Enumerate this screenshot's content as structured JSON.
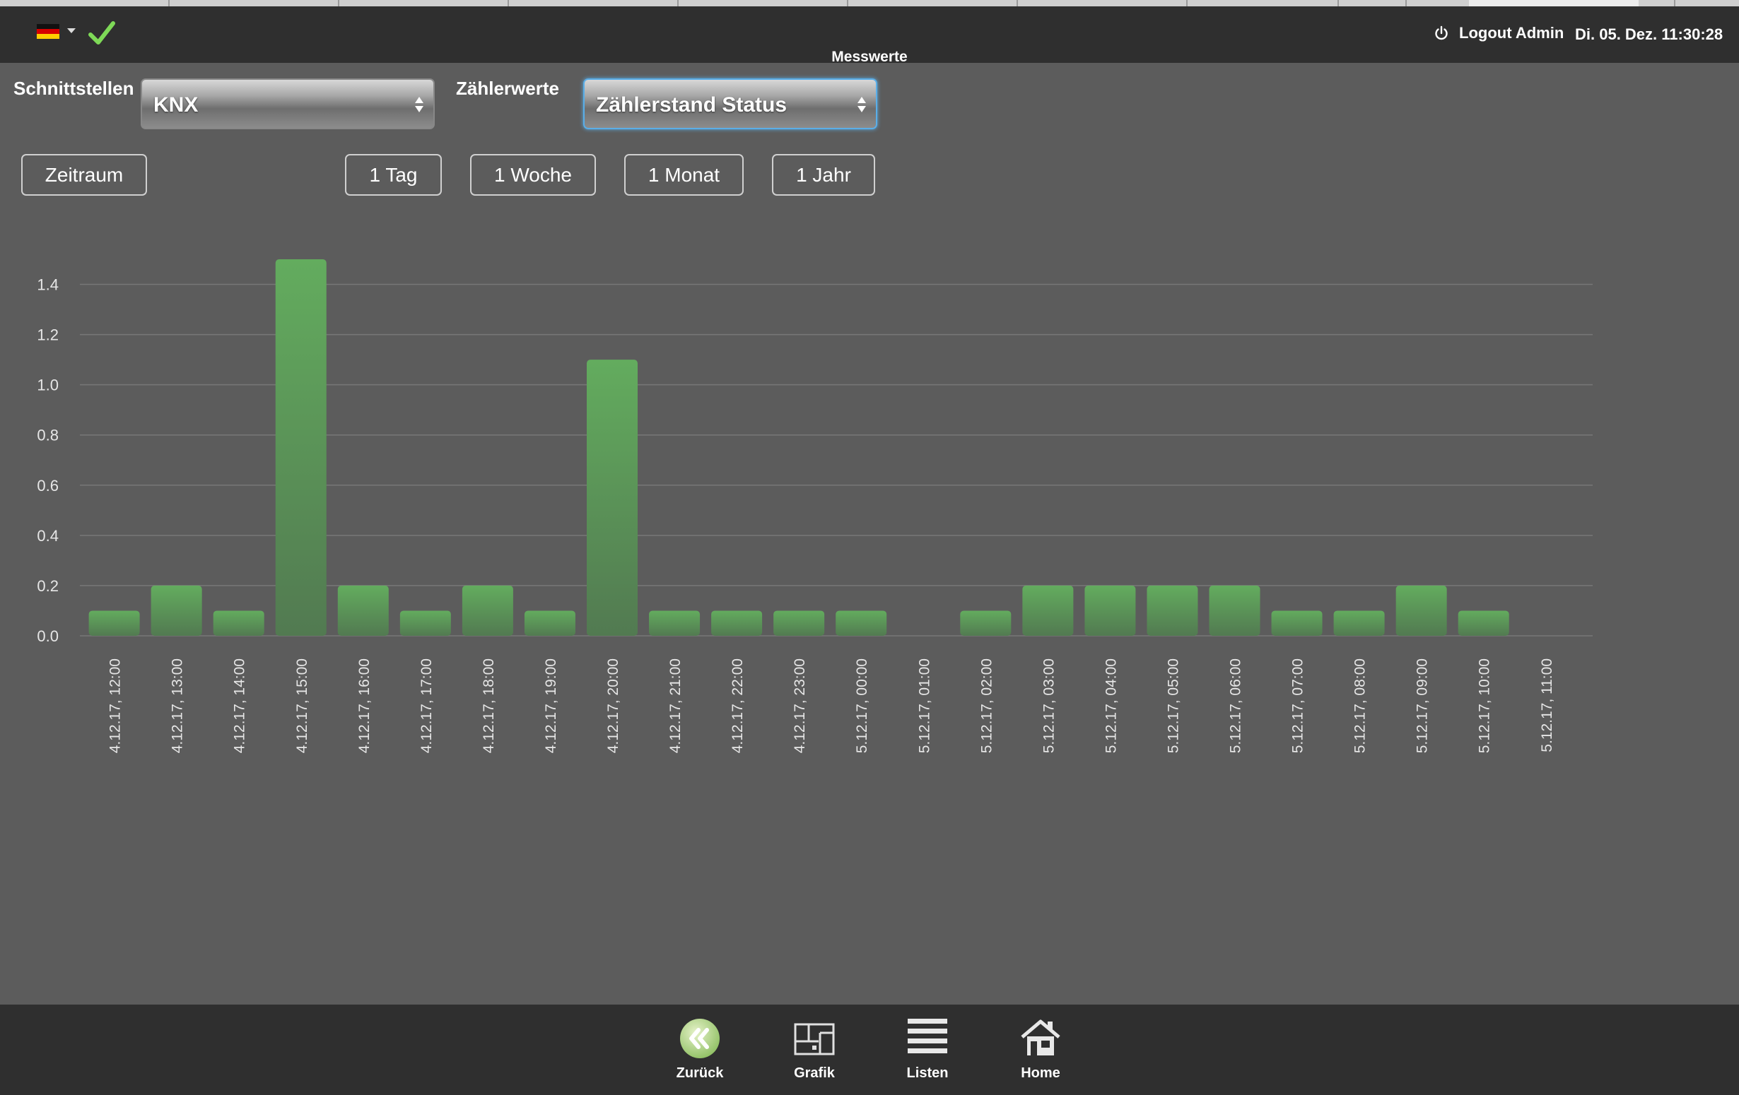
{
  "header": {
    "title": "Messwerte",
    "logout_label": "Logout Admin",
    "datetime": "Di. 05. Dez. 11:30:28",
    "language": "de"
  },
  "filters": {
    "interfaces_label": "Schnittstellen",
    "interfaces_value": "KNX",
    "meter_label": "Zählerwerte",
    "meter_value": "Zählerstand Status"
  },
  "timerange": {
    "custom_label": "Zeitraum",
    "day_label": "1 Tag",
    "week_label": "1 Woche",
    "month_label": "1 Monat",
    "year_label": "1 Jahr"
  },
  "chart_data": {
    "type": "bar",
    "categories": [
      "4.12.17, 12:00",
      "4.12.17, 13:00",
      "4.12.17, 14:00",
      "4.12.17, 15:00",
      "4.12.17, 16:00",
      "4.12.17, 17:00",
      "4.12.17, 18:00",
      "4.12.17, 19:00",
      "4.12.17, 20:00",
      "4.12.17, 21:00",
      "4.12.17, 22:00",
      "4.12.17, 23:00",
      "5.12.17, 00:00",
      "5.12.17, 01:00",
      "5.12.17, 02:00",
      "5.12.17, 03:00",
      "5.12.17, 04:00",
      "5.12.17, 05:00",
      "5.12.17, 06:00",
      "5.12.17, 07:00",
      "5.12.17, 08:00",
      "5.12.17, 09:00",
      "5.12.17, 10:00",
      "5.12.17, 11:00"
    ],
    "values": [
      0.1,
      0.2,
      0.1,
      1.5,
      0.2,
      0.1,
      0.2,
      0.1,
      1.1,
      0.1,
      0.1,
      0.1,
      0.1,
      0,
      0.1,
      0.2,
      0.2,
      0.2,
      0.2,
      0.1,
      0.1,
      0.2,
      0.1,
      0
    ],
    "yticks": [
      0.0,
      0.2,
      0.4,
      0.6,
      0.8,
      1.0,
      1.2,
      1.4
    ],
    "ylim": [
      0,
      1.5
    ],
    "grid": true,
    "bar_color": "#5fa55a"
  },
  "bottom_nav": {
    "back_label": "Zurück",
    "graphic_label": "Grafik",
    "lists_label": "Listen",
    "home_label": "Home"
  }
}
